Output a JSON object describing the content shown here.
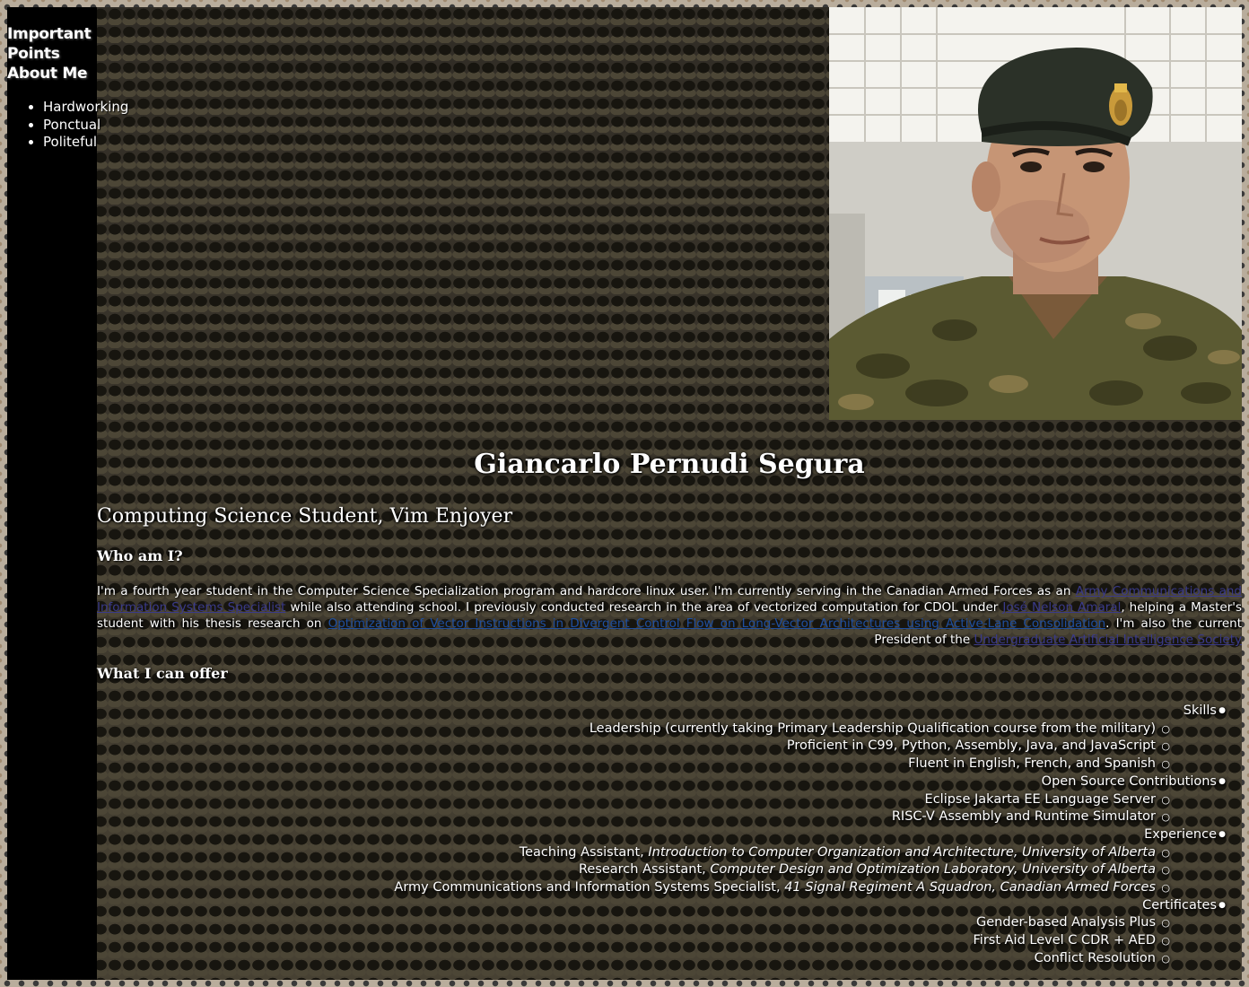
{
  "nav": {
    "items": [
      "Important Points",
      "About Me"
    ]
  },
  "traits": [
    "Hardworking",
    "Ponctual",
    "Politeful"
  ],
  "profile": {
    "name": "Giancarlo Pernudi Segura",
    "subtitle": "Computing Science Student, Vim Enjoyer",
    "photo_alt": "Portrait in military uniform and beret"
  },
  "who": {
    "heading": "Who am I?",
    "text_1": "I'm a fourth year student in the Computer Science Specialization program and hardcore linux user. I'm currently serving in the Canadian Armed Forces as an ",
    "link_1": "Army Communications and Information Systems Specialist",
    "text_2": " while also attending school. I previously conducted research in the area of vectorized computation for CDOL under ",
    "link_2": "José Nelson Amaral",
    "text_3": ", helping a Master's student with his thesis research on ",
    "link_3": "Optimization of Vector Instructions in Divergent Control Flow on Long-Vector Architectures using Active-Lane Consolidation",
    "text_4": ". I'm also the current President of the ",
    "link_4": "Undergraduate Artificial Intelligence Society"
  },
  "offer": {
    "heading": "What I can offer",
    "groups": [
      {
        "label": "Skills",
        "items": [
          {
            "text": "Leadership (currently taking Primary Leadership Qualification course from the military)",
            "emph": ""
          },
          {
            "text": "Proficient in C99, Python, Assembly, Java, and JavaScript",
            "emph": ""
          },
          {
            "text": "Fluent in English, French, and Spanish",
            "emph": ""
          }
        ]
      },
      {
        "label": "Open Source Contributions",
        "items": [
          {
            "text": "Eclipse Jakarta EE Language Server",
            "emph": ""
          },
          {
            "text": "RISC-V Assembly and Runtime Simulator",
            "emph": ""
          }
        ]
      },
      {
        "label": "Experience",
        "items": [
          {
            "text": "Teaching Assistant, ",
            "emph": "Introduction to Computer Organization and Architecture, University of Alberta"
          },
          {
            "text": "Research Assistant, ",
            "emph": "Computer Design and Optimization Laboratory, University of Alberta"
          },
          {
            "text": "Army Communications and Information Systems Specialist, ",
            "emph": "41 Signal Regiment A Squadron, Canadian Armed Forces"
          }
        ]
      },
      {
        "label": "Certificates",
        "items": [
          {
            "text": "Gender-based Analysis Plus",
            "emph": ""
          },
          {
            "text": "First Aid Level C CDR + AED",
            "emph": ""
          },
          {
            "text": "Conflict Resolution",
            "emph": ""
          }
        ]
      }
    ]
  }
}
